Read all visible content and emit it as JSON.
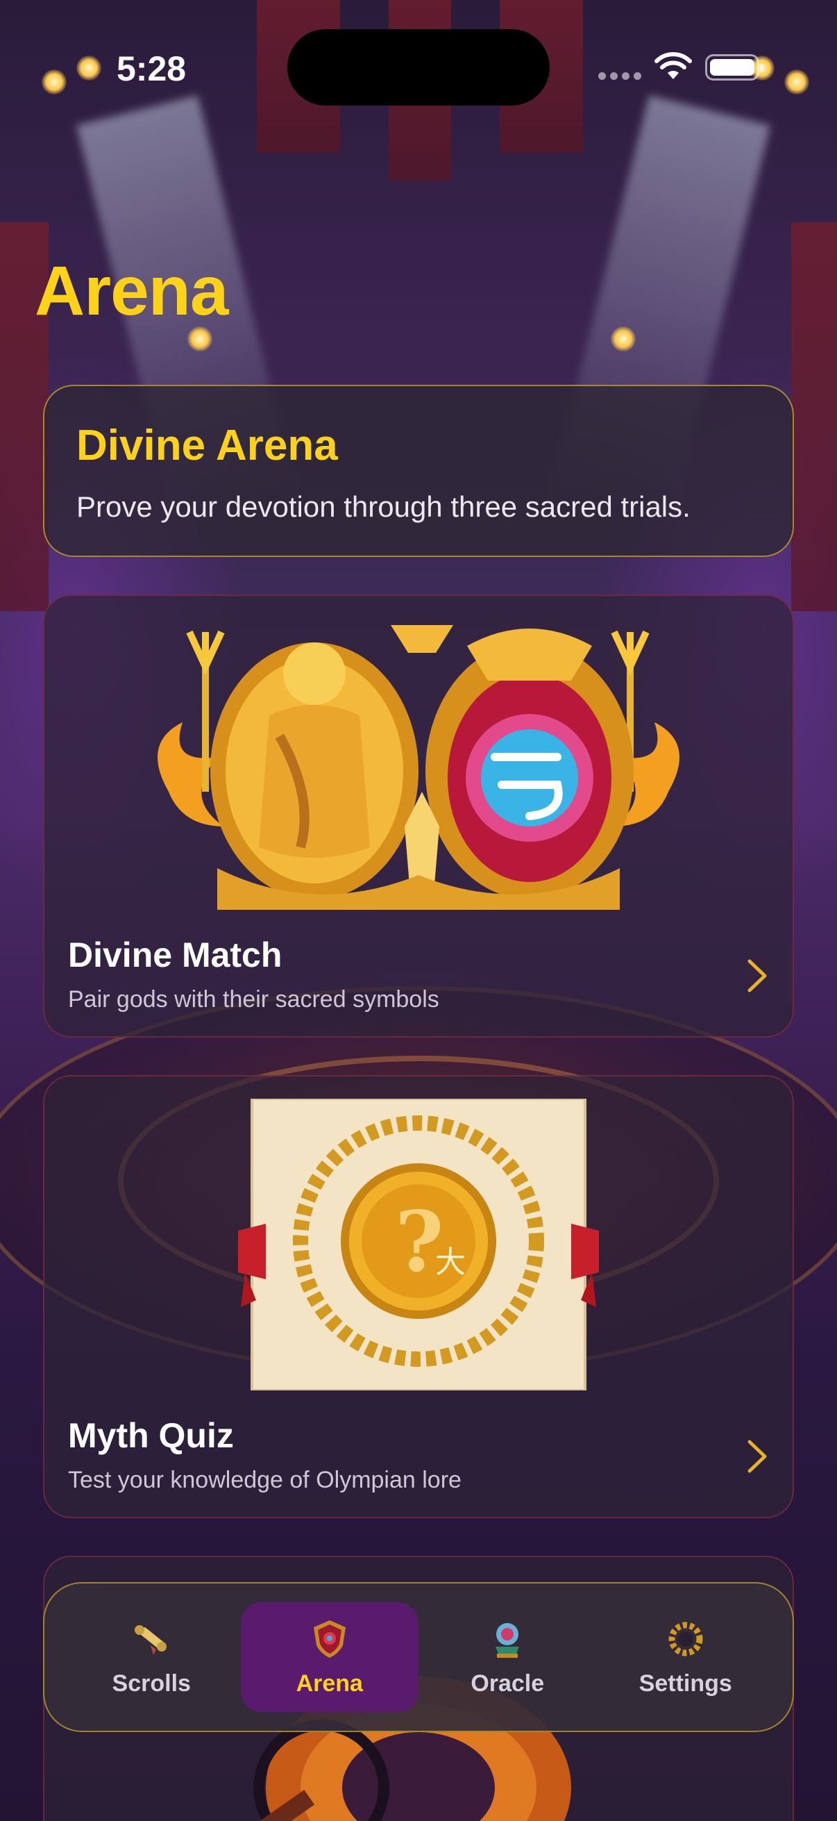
{
  "status_bar": {
    "time": "5:28"
  },
  "header": {
    "title": "Arena"
  },
  "intro": {
    "title": "Divine Arena",
    "subtitle": "Prove your devotion through three sacred trials."
  },
  "games": [
    {
      "title": "Divine Match",
      "subtitle": "Pair gods with their sacred symbols",
      "icon": "divine-match-art"
    },
    {
      "title": "Myth Quiz",
      "subtitle": "Test your knowledge of Olympian lore",
      "icon": "myth-quiz-scroll-art"
    }
  ],
  "tab_bar": {
    "items": [
      {
        "label": "Scrolls",
        "icon": "scroll-icon",
        "active": false
      },
      {
        "label": "Arena",
        "icon": "shield-icon",
        "active": true
      },
      {
        "label": "Oracle",
        "icon": "crystal-ball-icon",
        "active": false
      },
      {
        "label": "Settings",
        "icon": "laurel-wreath-icon",
        "active": false
      }
    ]
  },
  "colors": {
    "accent_gold": "#ffd21a",
    "active_tab": "#5a1a6e",
    "card_border_gold": "#d2aa28",
    "card_border_red": "#963246"
  }
}
